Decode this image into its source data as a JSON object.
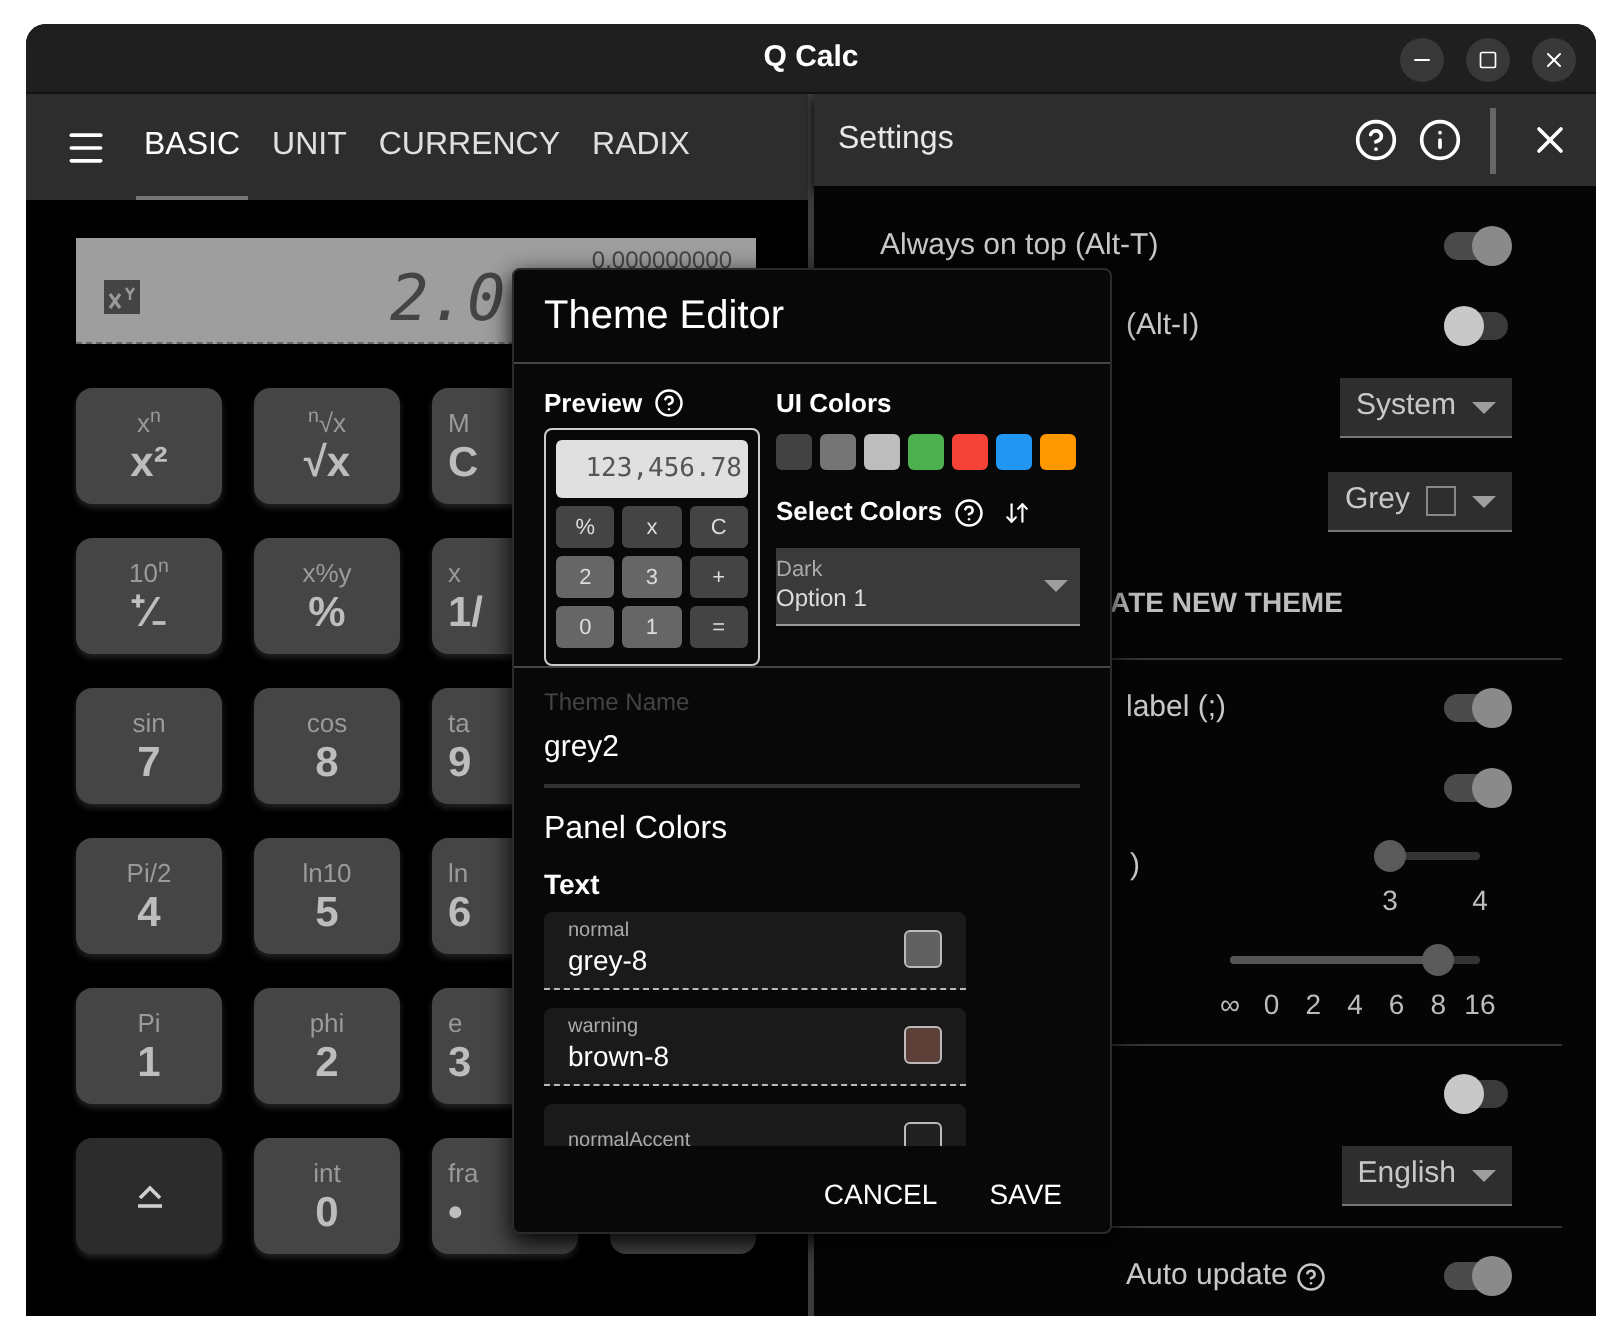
{
  "window": {
    "title": "Q Calc"
  },
  "toolbar": {
    "tabs": [
      {
        "label": "BASIC",
        "selected": true
      },
      {
        "label": "UNIT",
        "selected": false
      },
      {
        "label": "CURRENCY",
        "selected": false
      },
      {
        "label": "RADIX",
        "selected": false
      }
    ],
    "settings_title": "Settings"
  },
  "display": {
    "memory": "0.000000000",
    "value": "2.0"
  },
  "keypad": [
    {
      "keys": [
        {
          "sub": "x$^{n}$",
          "main": "x²"
        },
        {
          "sub": "$^{n}$√x",
          "main": "√x"
        },
        {
          "sub": "M",
          "main": "C"
        }
      ]
    },
    {
      "keys": [
        {
          "sub": "10$^{n}$",
          "main": "⁺∕₋"
        },
        {
          "sub": "x%y",
          "main": "%"
        },
        {
          "sub": "x",
          "main": "1/"
        }
      ]
    },
    {
      "keys": [
        {
          "sub": "sin",
          "main": "7"
        },
        {
          "sub": "cos",
          "main": "8"
        },
        {
          "sub": "ta",
          "main": "9"
        }
      ]
    },
    {
      "keys": [
        {
          "sub": "Pi/2",
          "main": "4"
        },
        {
          "sub": "ln10",
          "main": "5"
        },
        {
          "sub": "ln",
          "main": "6"
        }
      ]
    },
    {
      "keys": [
        {
          "sub": "Pi",
          "main": "1"
        },
        {
          "sub": "phi",
          "main": "2"
        },
        {
          "sub": "e",
          "main": "3"
        }
      ]
    },
    {
      "keys": [
        {
          "kind": "shift"
        },
        {
          "sub": "int",
          "main": "0"
        },
        {
          "sub": "fra",
          "main": "•"
        }
      ]
    }
  ],
  "settings": [
    {
      "kind": "toggle",
      "label": "Always on top (Alt-T)",
      "on": true
    },
    {
      "kind": "toggle",
      "label": "(Alt-I)",
      "on": false
    },
    {
      "kind": "select",
      "value": "System"
    },
    {
      "kind": "swatch_select",
      "value": "Grey"
    },
    {
      "kind": "header",
      "label": "ATE NEW THEME"
    },
    {
      "kind": "divider"
    },
    {
      "kind": "toggle",
      "label": "label (;)",
      "on": true
    },
    {
      "kind": "toggle",
      "on": true
    },
    {
      "kind": "slider",
      "label": ")",
      "level": 0,
      "ticks": [
        "3",
        "4"
      ]
    },
    {
      "kind": "slider",
      "level": 0.833,
      "ticks": [
        "∞",
        "0",
        "2",
        "4",
        "6",
        "8",
        "16"
      ]
    },
    {
      "kind": "divider"
    },
    {
      "kind": "toggle",
      "on": false
    },
    {
      "kind": "select",
      "value": "English"
    },
    {
      "kind": "divider"
    },
    {
      "kind": "toggle",
      "label": "Auto update",
      "help": true,
      "on": true
    }
  ],
  "dialog": {
    "title": "Theme Editor",
    "preview_label": "Preview",
    "preview_display": "123,456.78",
    "preview_keys": [
      {
        "label": "%",
        "kind": "dark"
      },
      {
        "label": "x",
        "kind": "dark"
      },
      {
        "label": "C",
        "kind": "dark"
      },
      {
        "label": "2",
        "kind": "light"
      },
      {
        "label": "3",
        "kind": "light"
      },
      {
        "label": "+",
        "kind": "dark"
      },
      {
        "label": "0",
        "kind": "light"
      },
      {
        "label": "1",
        "kind": "light"
      },
      {
        "label": "=",
        "kind": "dark"
      }
    ],
    "ui_colors_label": "UI Colors",
    "ui_colors": [
      {
        "color": "#424242"
      },
      {
        "color": "#757575"
      },
      {
        "color": "#bdbdbd"
      },
      {
        "color": "#4caf50"
      },
      {
        "color": "#f44336"
      },
      {
        "color": "#2196f3"
      },
      {
        "color": "#ff9800"
      }
    ],
    "select_colors_label": "Select Colors",
    "select": {
      "label": "Dark",
      "value": "Option 1"
    },
    "theme_name": {
      "label": "Theme Name",
      "value": "grey2"
    },
    "panel_colors_title": "Panel Colors",
    "text_title": "Text",
    "color_fields": [
      {
        "label": "normal",
        "value": "grey-8",
        "color": "#616161"
      },
      {
        "label": "warning",
        "value": "brown-8",
        "color": "#5d4037"
      },
      {
        "label": "normalAccent",
        "color": "#212121"
      }
    ],
    "buttons": [
      "CANCEL",
      "SAVE"
    ]
  }
}
